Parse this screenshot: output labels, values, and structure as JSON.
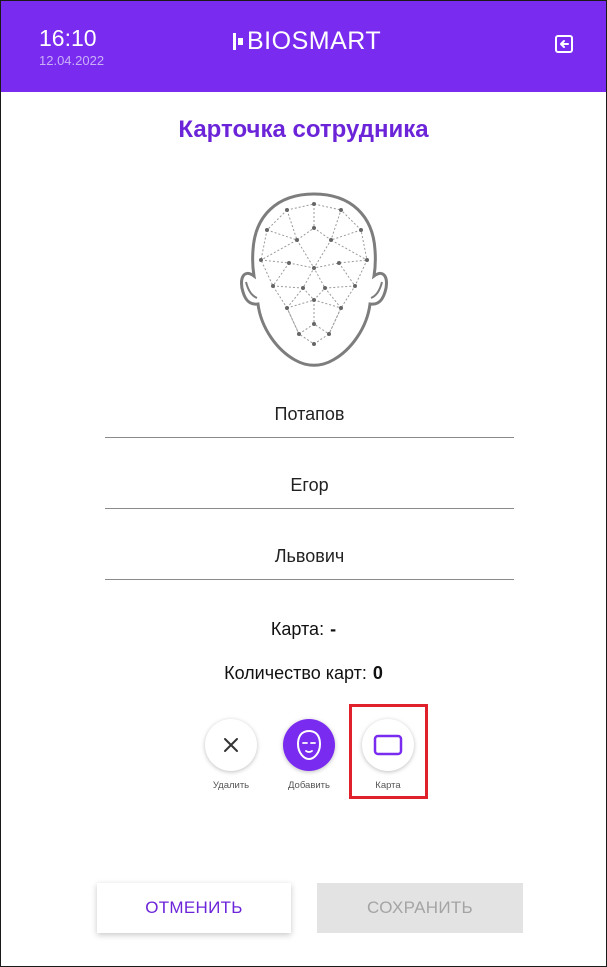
{
  "header": {
    "time": "16:10",
    "date": "12.04.2022",
    "logo_text": "BIOSMART",
    "exit_icon": "exit-icon",
    "background_color": "#7a2bf0"
  },
  "page": {
    "title": "Карточка сотрудника",
    "title_color": "#6c24d9"
  },
  "face_icon": "face-mesh-icon",
  "fields": {
    "last_name": "Потапов",
    "first_name": "Егор",
    "middle_name": "Львович"
  },
  "card_info": {
    "card_label": "Карта:",
    "card_value": "-",
    "count_label": "Количество карт:",
    "count_value": "0"
  },
  "actions": {
    "delete_label": "Удалить",
    "delete_icon": "close-icon",
    "add_label": "Добавить",
    "add_icon": "face-icon",
    "card_label": "Карта",
    "card_icon": "card-icon"
  },
  "buttons": {
    "cancel_label": "ОТМЕНИТЬ",
    "save_label": "СОХРАНИТЬ"
  },
  "highlight_color": "#e0202a"
}
